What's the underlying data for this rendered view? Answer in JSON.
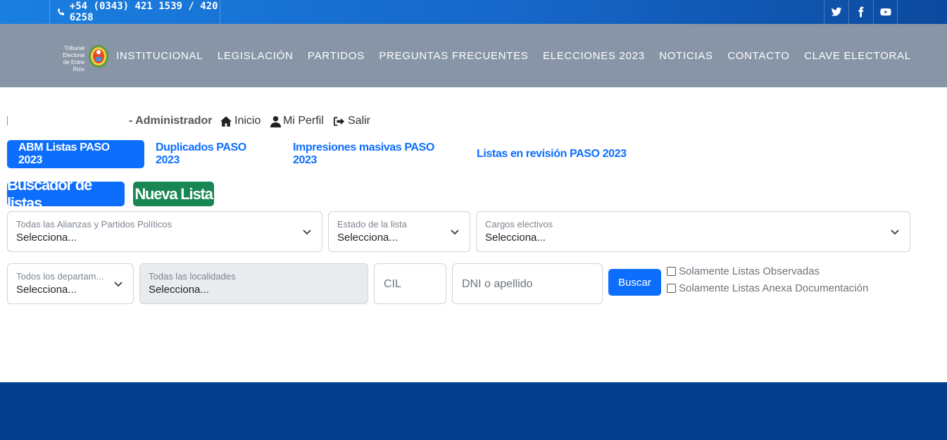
{
  "topbar": {
    "phone": "+54 (0343) 421 1539 / 420 6258",
    "social": [
      "twitter-icon",
      "facebook-icon",
      "youtube-icon"
    ]
  },
  "logo": {
    "text_line1": "Tribunal",
    "text_line2": "Electoral",
    "text_line3": "de Entre Ríos"
  },
  "nav": {
    "items": [
      "INSTITUCIONAL",
      "LEGISLACIÓN",
      "PARTIDOS",
      "PREGUNTAS FRECUENTES",
      "ELECCIONES 2023",
      "NOTICIAS",
      "CONTACTO",
      "CLAVE ELECTORAL"
    ]
  },
  "userbar": {
    "role": "- Administrador",
    "inicio": "Inicio",
    "perfil": "Mi Perfil",
    "salir": "Salir"
  },
  "tabs": [
    {
      "label": "ABM Listas PASO 2023",
      "active": true
    },
    {
      "label": "Duplicados PASO 2023",
      "active": false
    },
    {
      "label": "Impresiones masivas PASO 2023",
      "active": false
    },
    {
      "label": "Listas en revisión PASO 2023",
      "active": false
    }
  ],
  "actions": {
    "search": "Buscador de listas",
    "new": "Nueva Lista"
  },
  "filters": {
    "alianzas": {
      "label": "Todas las Alianzas y Partidos Políticos",
      "value": "Selecciona..."
    },
    "estado": {
      "label": "Estado de la lista",
      "value": "Selecciona..."
    },
    "cargos": {
      "label": "Cargos electivos",
      "value": "Selecciona..."
    },
    "departamentos": {
      "label": "Todos los departam...",
      "value": "Selecciona..."
    },
    "localidades": {
      "label": "Todas las localidades",
      "value": "Selecciona..."
    },
    "cil": {
      "placeholder": "CIL"
    },
    "dni": {
      "placeholder": "DNI o apellido"
    },
    "buscar": "Buscar",
    "chk_observadas": "Solamente Listas Observadas",
    "chk_anexa": "Solamente Listas Anexa Documentación"
  },
  "colors": {
    "primary": "#0d6efd",
    "success": "#198754",
    "navbar": "#8795a6",
    "footer": "#043c8e"
  }
}
